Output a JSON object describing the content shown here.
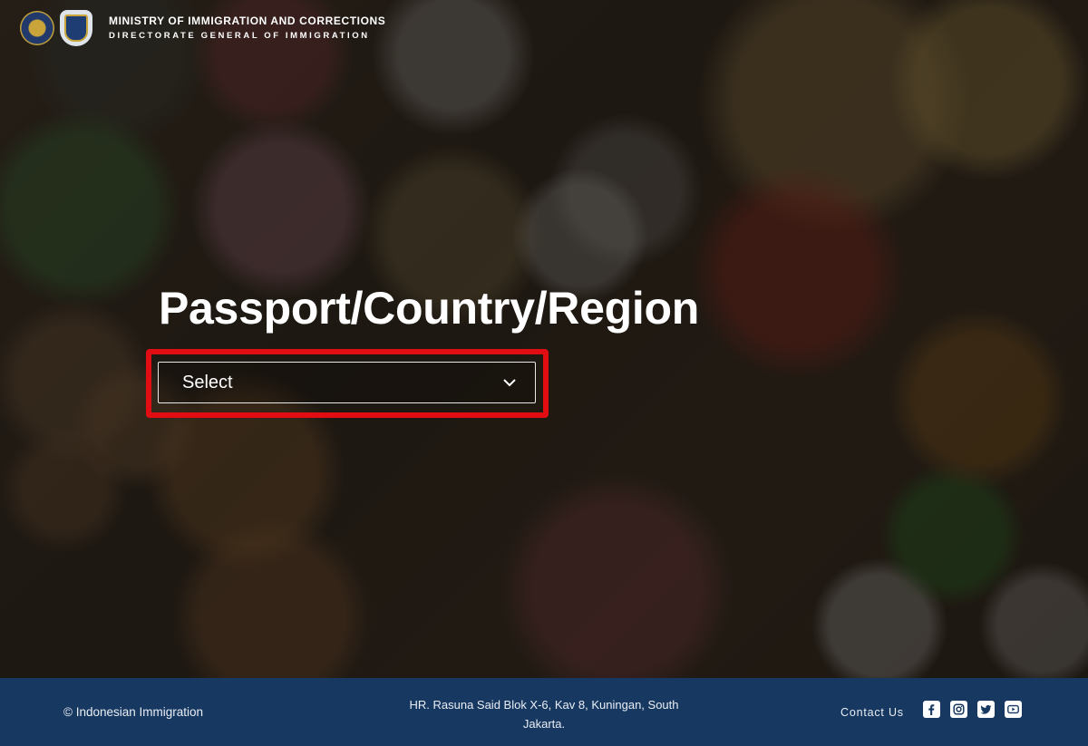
{
  "header": {
    "ministry_line1": "MINISTRY OF IMMIGRATION AND CORRECTIONS",
    "ministry_line2": "DIRECTORATE GENERAL OF IMMIGRATION"
  },
  "main": {
    "title": "Passport/Country/Region",
    "select": {
      "value": "Select",
      "icon": "chevron-down-icon"
    },
    "highlight_color": "#e10d12"
  },
  "footer": {
    "copyright": "© Indonesian Immigration",
    "address_line1": "HR. Rasuna Said Blok X-6, Kav 8, Kuningan, South",
    "address_line2": "Jakarta.",
    "contact_label": "Contact Us",
    "socials": [
      "facebook-icon",
      "instagram-icon",
      "twitter-icon",
      "youtube-icon"
    ],
    "background_color": "#173860"
  }
}
